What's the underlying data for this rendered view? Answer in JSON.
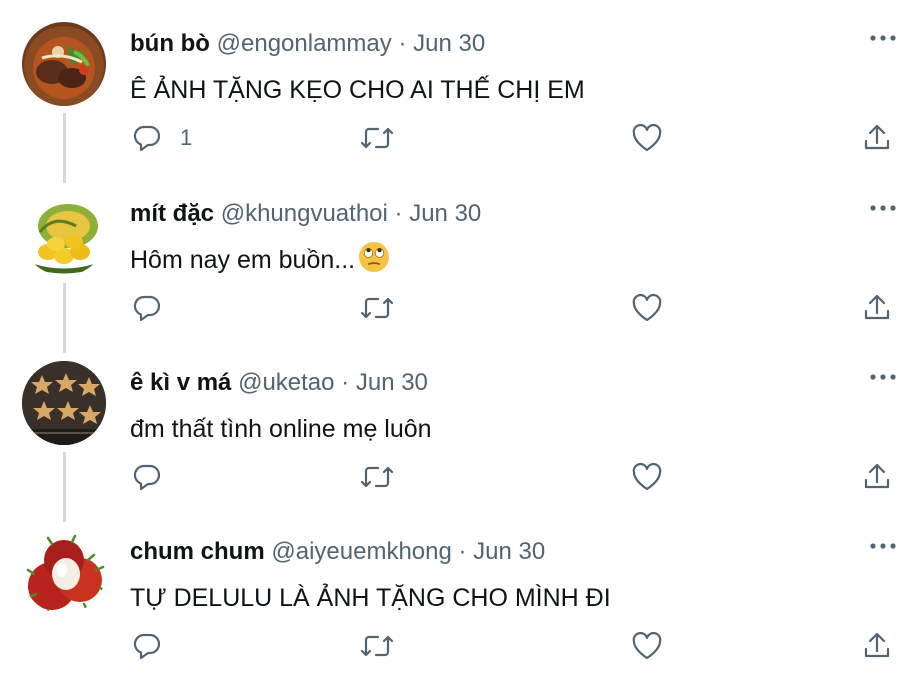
{
  "tweets": [
    {
      "name": "bún bò",
      "handle": "@engonlammay",
      "separator": "·",
      "date": "Jun 30",
      "text": "Ê ẢNH TẶNG KẸO CHO AI THẾ CHỊ EM",
      "reply_count": "1",
      "avatar": "bun-bo-noodle-bowl"
    },
    {
      "name": "mít đặc",
      "handle": "@khungvuathoi",
      "separator": "·",
      "date": "Jun 30",
      "text": "Hôm nay em buồn...",
      "emoji": "face-with-rolling-eyes",
      "reply_count": "",
      "avatar": "jackfruit"
    },
    {
      "name": "ê kì v má",
      "handle": "@uketao",
      "separator": "·",
      "date": "Jun 30",
      "text": "đm thất tình online mẹ luôn",
      "reply_count": "",
      "avatar": "star-cookies-tray"
    },
    {
      "name": "chum chum",
      "handle": "@aiyeuemkhong",
      "separator": "·",
      "date": "Jun 30",
      "text": "TỰ DELULU LÀ ẢNH TẶNG CHO MÌNH ĐI",
      "reply_count": "",
      "avatar": "rambutan"
    }
  ],
  "icons": {
    "reply": "reply-icon",
    "retweet": "retweet-icon",
    "like": "heart-icon",
    "share": "share-icon",
    "more": "more-icon"
  },
  "colors": {
    "text": "#0f1419",
    "secondary": "#536471",
    "thread_line": "#cfd9de",
    "background": "#ffffff"
  }
}
